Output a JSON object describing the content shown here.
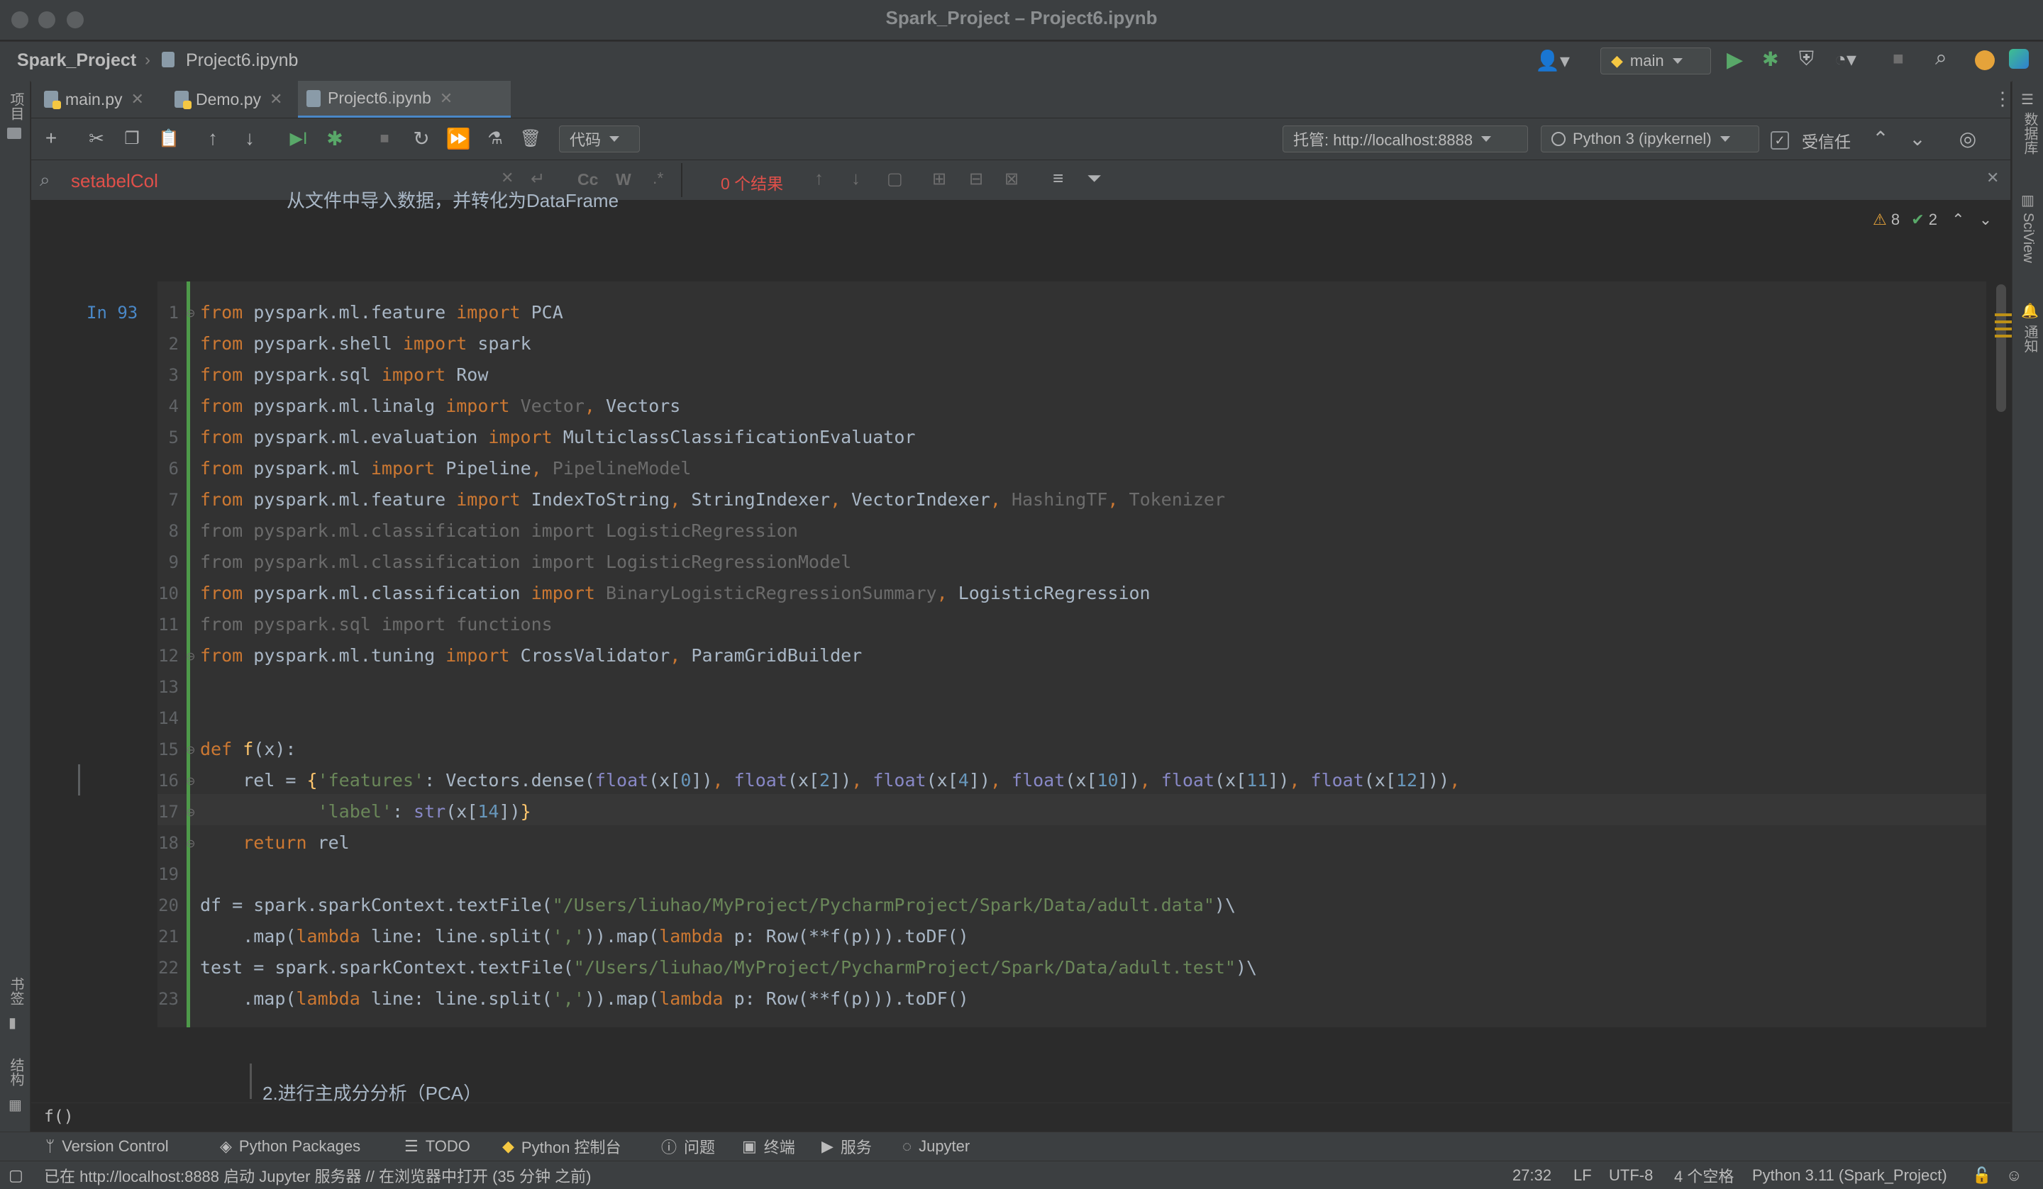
{
  "window": {
    "title": "Spark_Project – Project6.ipynb"
  },
  "breadcrumb": {
    "project": "Spark_Project",
    "file": "Project6.ipynb"
  },
  "nav": {
    "branch": "main"
  },
  "tabs": [
    {
      "label": "main.py"
    },
    {
      "label": "Demo.py"
    },
    {
      "label": "Project6.ipynb"
    }
  ],
  "toolbar": {
    "cell_type": "代码",
    "server": "托管: http://localhost:8888",
    "kernel": "Python 3 (ipykernel)",
    "trusted": "受信任"
  },
  "search": {
    "query": "setabelCol",
    "results": "0 个结果",
    "case_label": "Cc",
    "word_label": "W",
    "regex_label": ".*"
  },
  "inspections": {
    "warnings": "8",
    "checks": "2"
  },
  "markdown_above": "从文件中导入数据，并转化为DataFrame",
  "markdown_below": "2.进行主成分分析（PCA）",
  "cell": {
    "prompt": "In 93",
    "line_numbers": [
      "1",
      "2",
      "3",
      "4",
      "5",
      "6",
      "7",
      "8",
      "9",
      "10",
      "11",
      "12",
      "13",
      "14",
      "15",
      "16",
      "17",
      "18",
      "19",
      "20",
      "21",
      "22",
      "23"
    ]
  },
  "left_strip": {
    "project": "项目",
    "bookmarks": "书签",
    "structure": "结构"
  },
  "right_strip": {
    "database": "数据库",
    "sciview": "SciView",
    "notifications": "通知"
  },
  "breadcrumb_bottom": "f()",
  "tool_windows": [
    {
      "label": "Version Control"
    },
    {
      "label": "Python Packages"
    },
    {
      "label": "TODO"
    },
    {
      "label": "Python 控制台"
    },
    {
      "label": "问题"
    },
    {
      "label": "终端"
    },
    {
      "label": "服务"
    },
    {
      "label": "Jupyter"
    }
  ],
  "status": {
    "message": "已在 http://localhost:8888 启动 Jupyter 服务器 // 在浏览器中打开 (35 分钟 之前)",
    "position": "27:32",
    "line_sep": "LF",
    "encoding": "UTF-8",
    "indent": "4 个空格",
    "interpreter": "Python 3.11 (Spark_Project)"
  },
  "colors": {
    "keyword": "#cc7832",
    "string": "#6a8759",
    "builtin": "#8888c6",
    "number": "#6897bb",
    "accent": "#4a88c7"
  }
}
